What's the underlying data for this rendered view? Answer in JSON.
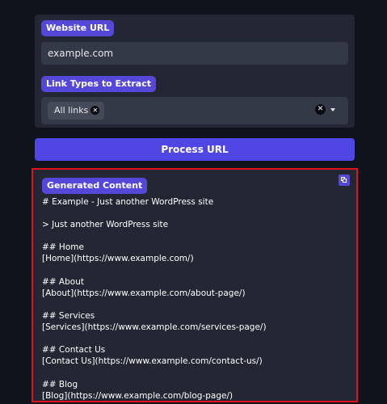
{
  "form": {
    "website_url_label": "Website URL",
    "website_url_value": "example.com",
    "link_types_label": "Link Types to Extract",
    "link_types_selected": [
      "All links"
    ]
  },
  "actions": {
    "process_label": "Process URL"
  },
  "result": {
    "label": "Generated Content",
    "lines": [
      "# Example - Just another WordPress site",
      "",
      "> Just another WordPress site",
      "",
      "## Home",
      "[Home](https://www.example.com/)",
      "",
      "## About",
      "[About](https://www.example.com/about-page/)",
      "",
      "## Services",
      "[Services](https://www.example.com/services-page/)",
      "",
      "## Contact Us",
      "[Contact Us](https://www.example.com/contact-us/)",
      "",
      "## Blog",
      "[Blog](https://www.example.com/blog-page/)"
    ]
  },
  "icons": {
    "chip_close_icon": "clear-selection-icon",
    "clear_icon": "clear-all-icon",
    "dropdown_icon": "chevron-down-icon",
    "copy_icon": "copy-icon"
  },
  "colors": {
    "background": "#0f131b",
    "panel": "#222733",
    "accent": "#5046e4",
    "highlight_border": "#e1121b"
  }
}
